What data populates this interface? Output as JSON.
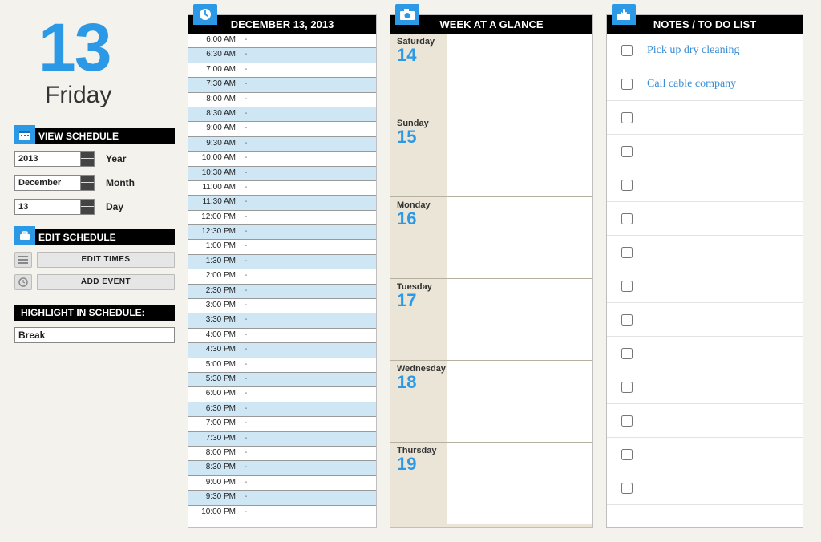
{
  "date": {
    "big_number": "13",
    "weekday": "Friday"
  },
  "sidebar": {
    "view_header": "VIEW SCHEDULE",
    "year_label": "Year",
    "year_value": "2013",
    "month_label": "Month",
    "month_value": "December",
    "day_label": "Day",
    "day_value": "13",
    "edit_header": "EDIT SCHEDULE",
    "edit_times_btn": "EDIT TIMES",
    "add_event_btn": "ADD EVENT",
    "highlight_header": "HIGHLIGHT IN SCHEDULE:",
    "highlight_value": "Break"
  },
  "schedule": {
    "header": "DECEMBER 13, 2013",
    "slots": [
      {
        "t": "6:00 AM",
        "e": "-"
      },
      {
        "t": "6:30 AM",
        "e": "-"
      },
      {
        "t": "7:00 AM",
        "e": "-"
      },
      {
        "t": "7:30 AM",
        "e": "-"
      },
      {
        "t": "8:00 AM",
        "e": "-"
      },
      {
        "t": "8:30 AM",
        "e": "-"
      },
      {
        "t": "9:00 AM",
        "e": "-"
      },
      {
        "t": "9:30 AM",
        "e": "-"
      },
      {
        "t": "10:00 AM",
        "e": "-"
      },
      {
        "t": "10:30 AM",
        "e": "-"
      },
      {
        "t": "11:00 AM",
        "e": "-"
      },
      {
        "t": "11:30 AM",
        "e": "-"
      },
      {
        "t": "12:00 PM",
        "e": "-"
      },
      {
        "t": "12:30 PM",
        "e": "-"
      },
      {
        "t": "1:00 PM",
        "e": "-"
      },
      {
        "t": "1:30 PM",
        "e": "-"
      },
      {
        "t": "2:00 PM",
        "e": "-"
      },
      {
        "t": "2:30 PM",
        "e": "-"
      },
      {
        "t": "3:00 PM",
        "e": "-"
      },
      {
        "t": "3:30 PM",
        "e": "-"
      },
      {
        "t": "4:00 PM",
        "e": "-"
      },
      {
        "t": "4:30 PM",
        "e": "-"
      },
      {
        "t": "5:00 PM",
        "e": "-"
      },
      {
        "t": "5:30 PM",
        "e": "-"
      },
      {
        "t": "6:00 PM",
        "e": "-"
      },
      {
        "t": "6:30 PM",
        "e": "-"
      },
      {
        "t": "7:00 PM",
        "e": "-"
      },
      {
        "t": "7:30 PM",
        "e": "-"
      },
      {
        "t": "8:00 PM",
        "e": "-"
      },
      {
        "t": "8:30 PM",
        "e": "-"
      },
      {
        "t": "9:00 PM",
        "e": "-"
      },
      {
        "t": "9:30 PM",
        "e": "-"
      },
      {
        "t": "10:00 PM",
        "e": "-"
      }
    ]
  },
  "week": {
    "header": "WEEK AT A GLANCE",
    "days": [
      {
        "name": "Saturday",
        "num": "14"
      },
      {
        "name": "Sunday",
        "num": "15"
      },
      {
        "name": "Monday",
        "num": "16"
      },
      {
        "name": "Tuesday",
        "num": "17"
      },
      {
        "name": "Wednesday",
        "num": "18"
      },
      {
        "name": "Thursday",
        "num": "19"
      }
    ]
  },
  "notes": {
    "header": "NOTES / TO DO LIST",
    "items": [
      {
        "text": "Pick up dry cleaning"
      },
      {
        "text": "Call cable company"
      },
      {
        "text": ""
      },
      {
        "text": ""
      },
      {
        "text": ""
      },
      {
        "text": ""
      },
      {
        "text": ""
      },
      {
        "text": ""
      },
      {
        "text": ""
      },
      {
        "text": ""
      },
      {
        "text": ""
      },
      {
        "text": ""
      },
      {
        "text": ""
      },
      {
        "text": ""
      }
    ]
  }
}
